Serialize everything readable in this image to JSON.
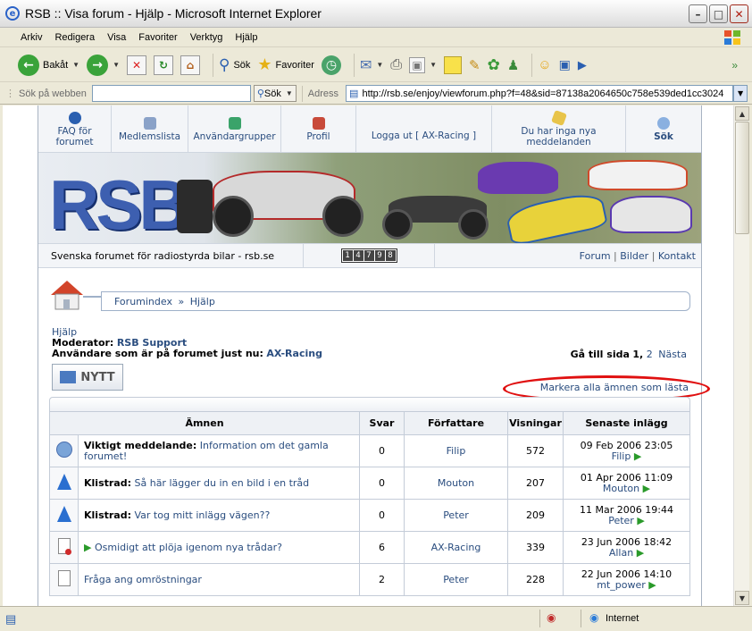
{
  "window": {
    "title": "RSB :: Visa forum - Hjälp - Microsoft Internet Explorer"
  },
  "menu": [
    "Arkiv",
    "Redigera",
    "Visa",
    "Favoriter",
    "Verktyg",
    "Hjälp"
  ],
  "toolbar": {
    "back": "Bakåt",
    "search": "Sök",
    "favorites": "Favoriter"
  },
  "addressbar": {
    "websearch_label": "Sök på webben",
    "websearch_button": "Sök",
    "address_label": "Adress",
    "url": "http://rsb.se/enjoy/viewforum.php?f=48&sid=87138a2064650c758e539ded1cc3024"
  },
  "forum_nav": [
    {
      "label": "FAQ för forumet",
      "icon": "faq-icon"
    },
    {
      "label": "Medlemslista",
      "icon": "memberlist-icon"
    },
    {
      "label": "Användargrupper",
      "icon": "usergroups-icon"
    },
    {
      "label": "Profil",
      "icon": "profile-icon"
    },
    {
      "label": "Logga ut [ AX-Racing ]",
      "icon": "logout-icon"
    },
    {
      "label": "Du har inga nya meddelanden",
      "icon": "messages-icon"
    },
    {
      "label": "Sök",
      "icon": "search-icon"
    }
  ],
  "banner": {
    "logo": "RSB"
  },
  "infobar": {
    "tagline": "Svenska forumet för radiostyrda bilar - rsb.se",
    "counter": "14798",
    "links": [
      "Forum",
      "Bilder",
      "Kontakt"
    ]
  },
  "breadcrumb": {
    "home": "Forumindex",
    "sep": "»",
    "current": "Hjälp"
  },
  "forum": {
    "name": "Hjälp",
    "moderator_label": "Moderator:",
    "moderator": "RSB Support",
    "users_label": "Användare som är på forumet just nu:",
    "users": "AX-Racing",
    "goto_label": "Gå till sida",
    "page_current": "1",
    "page_next_num": "2",
    "page_next": "Nästa",
    "new_button": "NYTT",
    "mark_read": "Markera alla ämnen som lästa"
  },
  "table": {
    "headers": [
      "Ämnen",
      "Svar",
      "Författare",
      "Visningar",
      "Senaste inlägg"
    ],
    "rows": [
      {
        "icon": "announcement-icon",
        "prefix": "Viktigt meddelande:",
        "title": "Information om det gamla forumet!",
        "replies": "0",
        "author": "Filip",
        "views": "572",
        "last_date": "09 Feb 2006 23:05",
        "last_user": "Filip"
      },
      {
        "icon": "sticky-icon",
        "prefix": "Klistrad:",
        "title": "Så här lägger du in en bild i en tråd",
        "replies": "0",
        "author": "Mouton",
        "views": "207",
        "last_date": "01 Apr 2006 11:09",
        "last_user": "Mouton"
      },
      {
        "icon": "sticky-icon",
        "prefix": "Klistrad:",
        "title": "Var tog mitt inlägg vägen??",
        "replies": "0",
        "author": "Peter",
        "views": "209",
        "last_date": "11 Mar 2006 19:44",
        "last_user": "Peter"
      },
      {
        "icon": "topic-new-icon",
        "prefix": "",
        "title": "Osmidigt att plöja igenom nya trådar?",
        "replies": "6",
        "author": "AX-Racing",
        "views": "339",
        "last_date": "23 Jun 2006 18:42",
        "last_user": "Allan"
      },
      {
        "icon": "topic-icon",
        "prefix": "",
        "title": "Fråga ang omröstningar",
        "replies": "2",
        "author": "Peter",
        "views": "228",
        "last_date": "22 Jun 2006 14:10",
        "last_user": "mt_power"
      }
    ]
  },
  "status": {
    "zone": "Internet"
  },
  "colors": {
    "link": "#2a4d7f",
    "accent": "#3d5fb0",
    "annotation": "#e01010"
  }
}
